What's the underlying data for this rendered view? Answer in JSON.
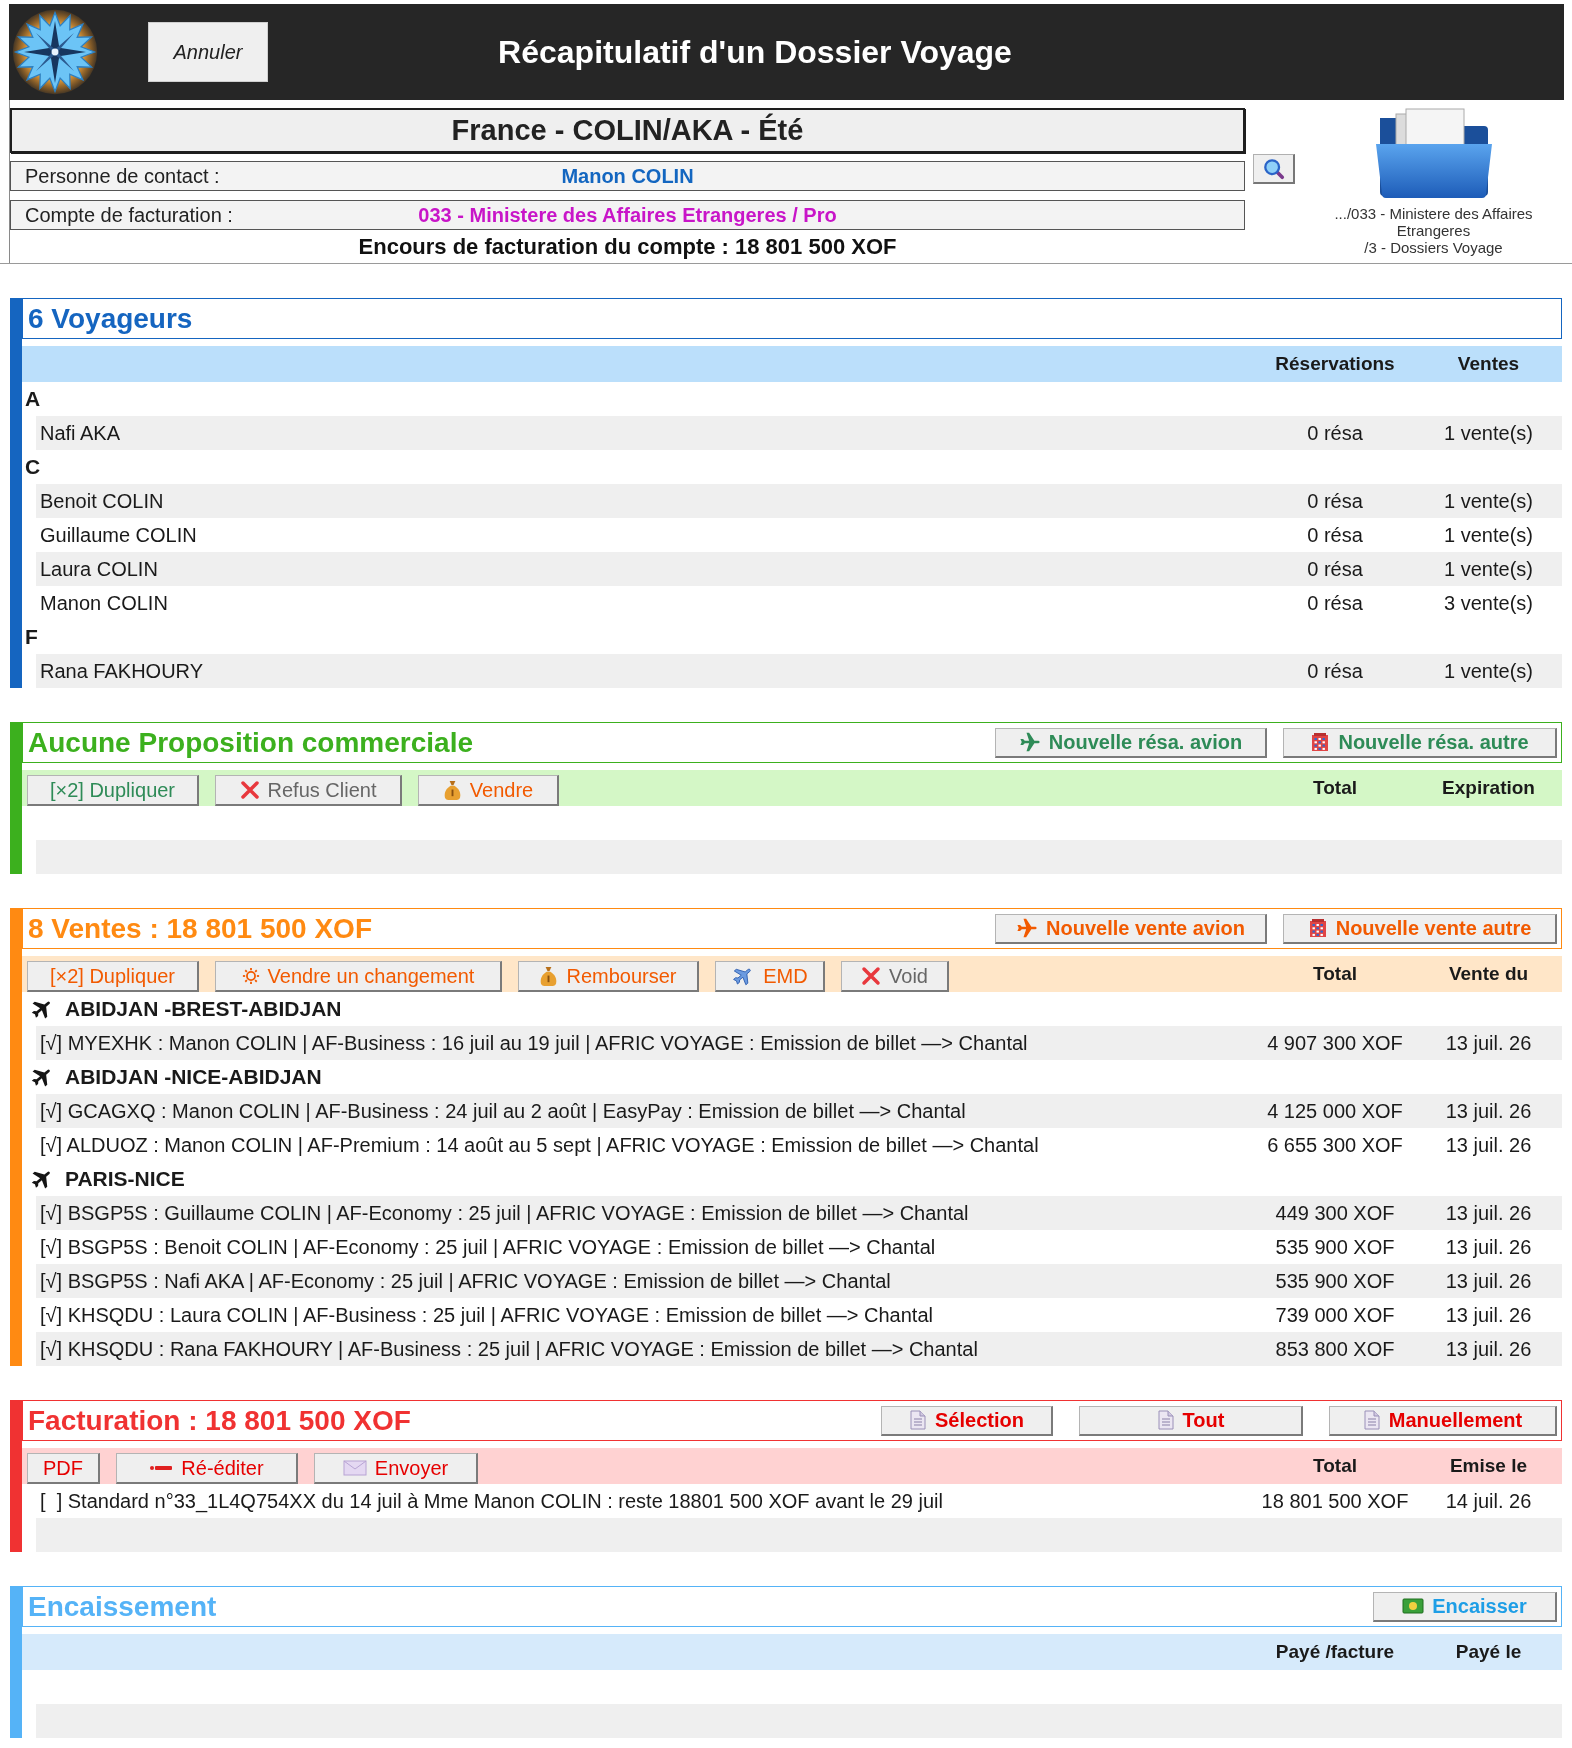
{
  "header": {
    "cancel_button": "Annuler",
    "title": "Récapitulatif d'un Dossier Voyage"
  },
  "dossier": {
    "title": "France - COLIN/AKA - Été",
    "contact": {
      "label": "Personne de contact :",
      "value": "Manon COLIN"
    },
    "billing_account": {
      "label": "Compte de facturation :",
      "value": "033 - Ministere des Affaires Etrangeres / Pro"
    },
    "outstanding": "Encours de facturation du compte : 18 801 500 XOF"
  },
  "folder": {
    "path_lines": [
      ".../033 - Ministere des Affaires",
      "Etrangeres",
      "/3 - Dossiers Voyage"
    ]
  },
  "sections": [
    {
      "kind": "travellers",
      "title": "6 Voyageurs",
      "color": "#1565c0",
      "columns": [
        "Réservations",
        "Ventes"
      ],
      "groups": [
        {
          "letter": "A",
          "items": [
            {
              "name": "Nafi AKA",
              "reservations": "0 résa",
              "sales": "1 vente(s)"
            }
          ]
        },
        {
          "letter": "C",
          "items": [
            {
              "name": "Benoit COLIN",
              "reservations": "0 résa",
              "sales": "1 vente(s)"
            },
            {
              "name": "Guillaume COLIN",
              "reservations": "0 résa",
              "sales": "1 vente(s)"
            },
            {
              "name": "Laura COLIN",
              "reservations": "0 résa",
              "sales": "1 vente(s)"
            },
            {
              "name": "Manon COLIN",
              "reservations": "0 résa",
              "sales": "3 vente(s)"
            }
          ]
        },
        {
          "letter": "F",
          "items": [
            {
              "name": "Rana FAKHOURY",
              "reservations": "0 résa",
              "sales": "1 vente(s)"
            }
          ]
        }
      ]
    },
    {
      "kind": "proposals",
      "title": "Aucune Proposition commerciale",
      "color": "#3cb01e",
      "header_actions": [
        {
          "kind": "new-flight",
          "label": "Nouvelle résa. avion"
        },
        {
          "kind": "new-other",
          "label": "Nouvelle résa. autre"
        }
      ],
      "actions": [
        {
          "kind": "duplicate",
          "label": "[×2] Dupliquer"
        },
        {
          "kind": "refuse",
          "label": "Refus Client"
        },
        {
          "kind": "sell",
          "label": "Vendre"
        }
      ],
      "columns": [
        "Total",
        "Expiration"
      ]
    },
    {
      "kind": "sales",
      "title": "8 Ventes : 18 801 500 XOF",
      "color": "#ff8a12",
      "header_actions": [
        {
          "kind": "new-flight",
          "label": "Nouvelle vente avion"
        },
        {
          "kind": "new-other",
          "label": "Nouvelle vente autre"
        }
      ],
      "actions": [
        {
          "kind": "duplicate",
          "label": "[×2] Dupliquer"
        },
        {
          "kind": "change",
          "label": "Vendre un changement"
        },
        {
          "kind": "refund",
          "label": "Rembourser"
        },
        {
          "kind": "emd",
          "label": "EMD"
        },
        {
          "kind": "void",
          "label": "Void"
        }
      ],
      "columns": [
        "Total",
        "Vente du"
      ],
      "groups": [
        {
          "route": "ABIDJAN -BREST-ABIDJAN",
          "items": [
            {
              "description": "[√] MYEXHK : Manon COLIN | AF-Business : 16 juil au 19 juil | AFRIC VOYAGE : Emission de billet —> Chantal",
              "total": "4 907 300 XOF",
              "date": "13 juil. 26"
            }
          ]
        },
        {
          "route": "ABIDJAN -NICE-ABIDJAN",
          "items": [
            {
              "description": "[√] GCAGXQ : Manon COLIN | AF-Business : 24 juil au 2 août | EasyPay : Emission de billet —> Chantal",
              "total": "4 125 000 XOF",
              "date": "13 juil. 26"
            },
            {
              "description": "[√] ALDUOZ : Manon COLIN | AF-Premium : 14 août au 5 sept | AFRIC VOYAGE : Emission de billet —> Chantal",
              "total": "6 655 300 XOF",
              "date": "13 juil. 26"
            }
          ]
        },
        {
          "route": "PARIS-NICE",
          "items": [
            {
              "description": "[√] BSGP5S : Guillaume COLIN | AF-Economy : 25 juil | AFRIC VOYAGE : Emission de billet —> Chantal",
              "total": "449 300 XOF",
              "date": "13 juil. 26"
            },
            {
              "description": "[√] BSGP5S : Benoit COLIN | AF-Economy : 25 juil | AFRIC VOYAGE : Emission de billet —> Chantal",
              "total": "535 900 XOF",
              "date": "13 juil. 26"
            },
            {
              "description": "[√] BSGP5S : Nafi AKA | AF-Economy : 25 juil | AFRIC VOYAGE : Emission de billet —> Chantal",
              "total": "535 900 XOF",
              "date": "13 juil. 26"
            },
            {
              "description": "[√] KHSQDU : Laura COLIN | AF-Business : 25 juil | AFRIC VOYAGE : Emission de billet —> Chantal",
              "total": "739 000 XOF",
              "date": "13 juil. 26"
            },
            {
              "description": "[√] KHSQDU : Rana FAKHOURY | AF-Business : 25 juil | AFRIC VOYAGE : Emission de billet —> Chantal",
              "total": "853 800 XOF",
              "date": "13 juil. 26"
            }
          ]
        }
      ]
    },
    {
      "kind": "invoices",
      "title": "Facturation : 18 801 500 XOF",
      "color": "#f03232",
      "header_actions": [
        {
          "kind": "selection",
          "label": "Sélection"
        },
        {
          "kind": "all",
          "label": "Tout"
        },
        {
          "kind": "manual",
          "label": "Manuellement"
        }
      ],
      "actions": [
        {
          "kind": "pdf",
          "label": "PDF"
        },
        {
          "kind": "reissue",
          "label": "Ré-éditer"
        },
        {
          "kind": "send",
          "label": "Envoyer"
        }
      ],
      "columns": [
        "Total",
        "Emise le"
      ],
      "rows": [
        {
          "description": "[  ] Standard n°33_1L4Q754XX du 14 juil à Mme Manon COLIN : reste 18801 500 XOF avant le 29 juil",
          "total": "18 801 500 XOF",
          "date": "14 juil. 26"
        }
      ]
    },
    {
      "kind": "payments",
      "title": "Encaissement",
      "color": "#55b3f7",
      "header_actions": [
        {
          "kind": "collect",
          "label": "Encaisser"
        }
      ],
      "columns": [
        "Payé /facture",
        "Payé le"
      ]
    }
  ]
}
